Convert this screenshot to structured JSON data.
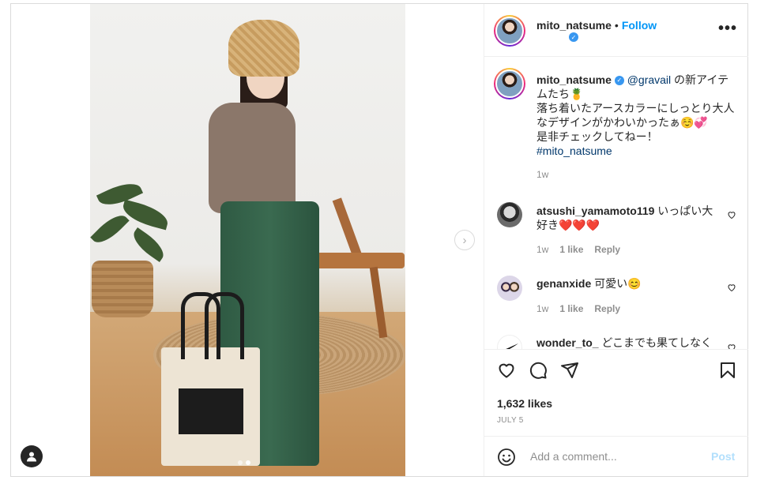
{
  "post": {
    "username": "mito_natsume",
    "follow_label": "Follow",
    "separator": "•",
    "more_label": "•••"
  },
  "caption": {
    "username": "mito_natsume",
    "mention": "@gravail",
    "line1_suffix": " の新アイテムたち🍍",
    "line2": "落ち着いたアースカラーにしっとり大人なデザインがかわいかったぁ☺️💞",
    "line3": "是非チェックしてねー！",
    "hashtag": "#mito_natsume",
    "time": "1w"
  },
  "comments": [
    {
      "username": "atsushi_yamamoto119",
      "text": "いっぱい大好き❤️❤️❤️",
      "time": "1w",
      "likes": "1 like",
      "reply": "Reply"
    },
    {
      "username": "genanxide",
      "text": "可愛い😊",
      "time": "1w",
      "likes": "1 like",
      "reply": "Reply"
    },
    {
      "username": "wonder_to_",
      "text": "どこまでも果てしなく"
    }
  ],
  "likes_label": "1,632 likes",
  "date_label": "JULY 5",
  "add_comment": {
    "placeholder": "Add a comment...",
    "post_label": "Post"
  },
  "carousel": {
    "next_glyph": "›",
    "total_slides": 2,
    "current_slide": 2
  },
  "colors": {
    "link": "#0095f6",
    "mention": "#00376b",
    "muted": "#8e8e8e",
    "post_disabled": "#b2dffc"
  },
  "icons": [
    "verified-icon",
    "more-options-icon",
    "heart-icon",
    "comment-icon",
    "share-icon",
    "bookmark-icon",
    "emoji-icon",
    "user-icon",
    "chevron-right-icon"
  ]
}
